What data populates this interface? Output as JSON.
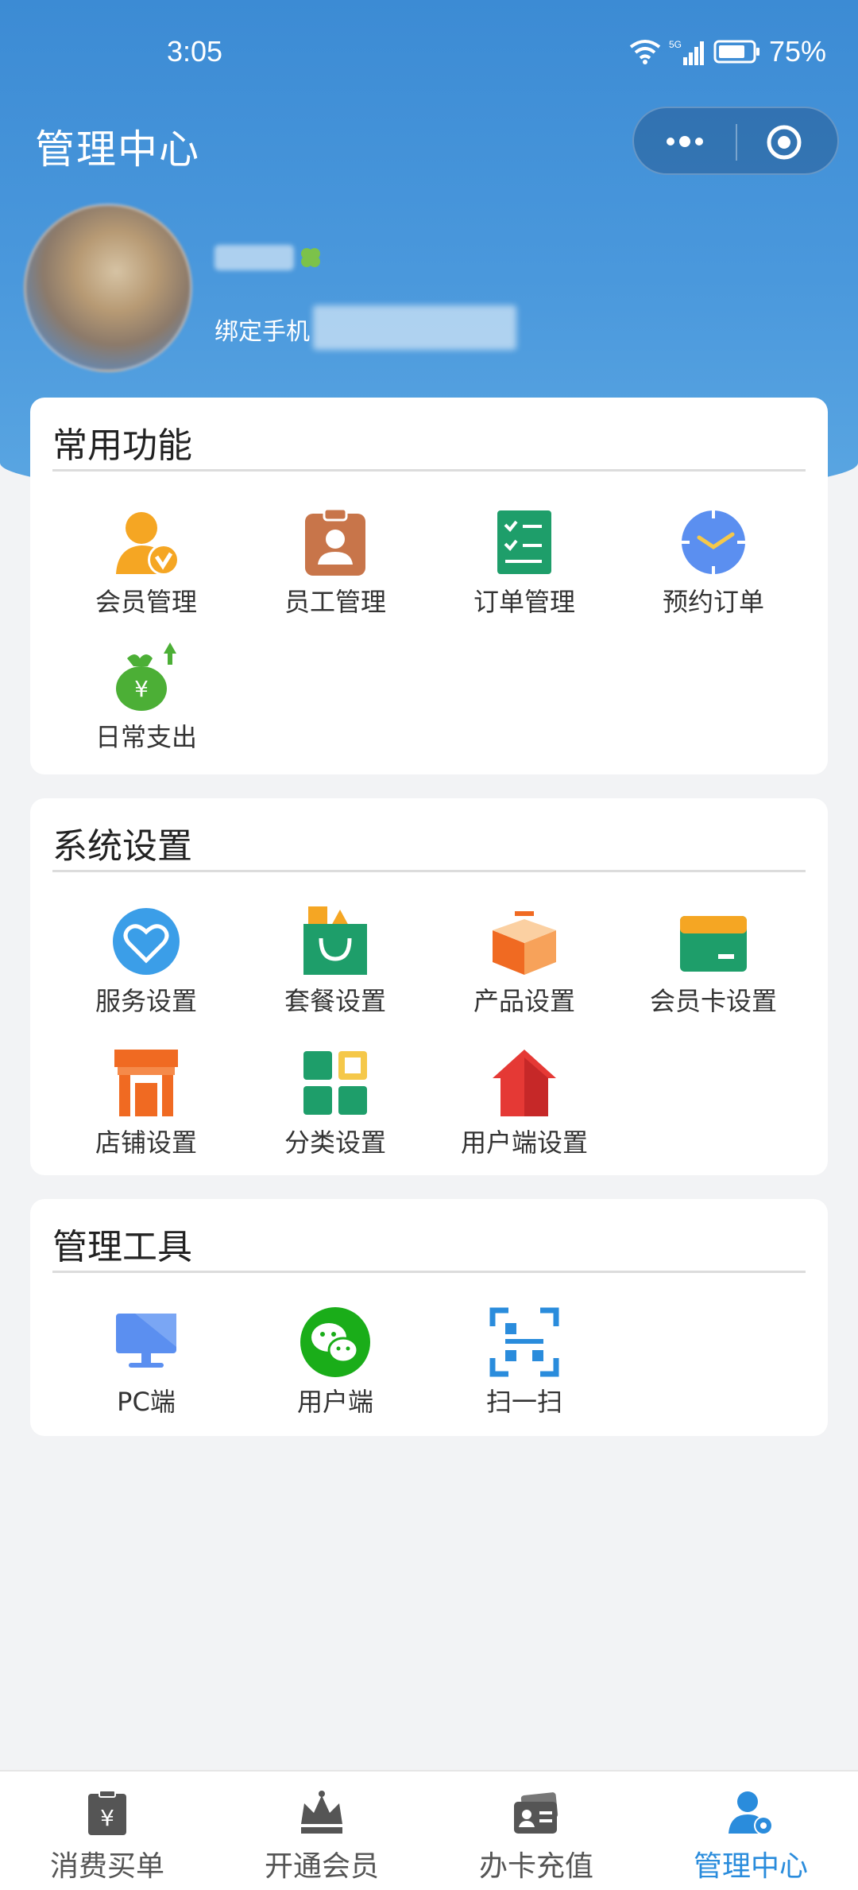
{
  "status_bar": {
    "time": "3:05",
    "network": "5G",
    "battery": "75%"
  },
  "header": {
    "title": "管理中心"
  },
  "profile": {
    "bind_phone_label": "绑定手机"
  },
  "sections": {
    "common": {
      "title": "常用功能",
      "items": [
        {
          "label": "会员管理",
          "icon": "member-manage-icon"
        },
        {
          "label": "员工管理",
          "icon": "staff-badge-icon"
        },
        {
          "label": "订单管理",
          "icon": "order-list-icon"
        },
        {
          "label": "预约订单",
          "icon": "clock-icon"
        },
        {
          "label": "日常支出",
          "icon": "money-bag-icon"
        }
      ]
    },
    "system": {
      "title": "系统设置",
      "items": [
        {
          "label": "服务设置",
          "icon": "heart-icon"
        },
        {
          "label": "套餐设置",
          "icon": "shopping-bag-icon"
        },
        {
          "label": "产品设置",
          "icon": "box-icon"
        },
        {
          "label": "会员卡设置",
          "icon": "card-icon"
        },
        {
          "label": "店铺设置",
          "icon": "store-icon"
        },
        {
          "label": "分类设置",
          "icon": "category-grid-icon"
        },
        {
          "label": "用户端设置",
          "icon": "house-icon"
        }
      ]
    },
    "tools": {
      "title": "管理工具",
      "items": [
        {
          "label": "PC端",
          "icon": "monitor-icon"
        },
        {
          "label": "用户端",
          "icon": "wechat-icon"
        },
        {
          "label": "扫一扫",
          "icon": "scan-icon"
        }
      ]
    }
  },
  "tabbar": {
    "active": 3,
    "items": [
      {
        "label": "消费买单",
        "icon": "receipt-yen-icon"
      },
      {
        "label": "开通会员",
        "icon": "crown-icon"
      },
      {
        "label": "办卡充值",
        "icon": "id-card-icon"
      },
      {
        "label": "管理中心",
        "icon": "user-settings-icon"
      }
    ]
  },
  "colors": {
    "header_blue": "#3c8bd4",
    "tab_active": "#2a8cdc",
    "background": "#f2f3f5"
  }
}
